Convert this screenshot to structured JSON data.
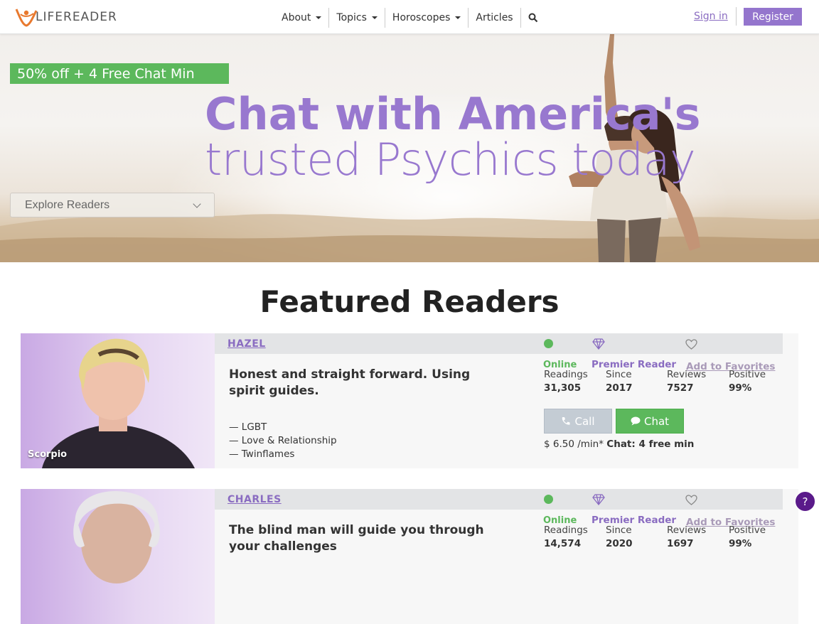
{
  "brand": {
    "logo_text": "LIFEREADER"
  },
  "nav": {
    "items": [
      {
        "label": "About",
        "dropdown": true
      },
      {
        "label": "Topics",
        "dropdown": true
      },
      {
        "label": "Horoscopes",
        "dropdown": true
      },
      {
        "label": "Articles",
        "dropdown": false
      }
    ],
    "search_icon": "search-icon",
    "signin_label": "Sign in",
    "register_label": "Register"
  },
  "hero": {
    "promo": "50% off + 4 Free Chat Min",
    "title_line1": "Chat with America's",
    "title_line2": "trusted Psychics today",
    "explore_placeholder": "Explore Readers"
  },
  "featured": {
    "title": "Featured Readers",
    "labels": {
      "online": "Online",
      "premier": "Premier Reader",
      "favorites": "Add to Favorites",
      "readings": "Readings",
      "since": "Since",
      "reviews": "Reviews",
      "positive": "Positive",
      "call": "Call",
      "chat": "Chat"
    },
    "readers": [
      {
        "name": "HAZEL",
        "sign": "Scorpio",
        "tagline": "Honest and straight forward. Using spirit guides.",
        "readings": "31,305",
        "since": "2017",
        "reviews": "7527",
        "positive": "99%",
        "topics": [
          "— LGBT",
          "— Love & Relationship",
          "— Twinflames"
        ],
        "price": "$ 6.50 /min*",
        "chat_offer": "Chat: 4 free min"
      },
      {
        "name": "CHARLES",
        "sign": "",
        "tagline": "The blind man will guide you through your challenges",
        "readings": "14,574",
        "since": "2020",
        "reviews": "1697",
        "positive": "99%",
        "topics": [],
        "price": "",
        "chat_offer": ""
      }
    ]
  },
  "help": {
    "label": "?"
  },
  "colors": {
    "brand_purple": "#9475cd",
    "online_green": "#5cb85c",
    "promo_green": "#5cb85c"
  }
}
